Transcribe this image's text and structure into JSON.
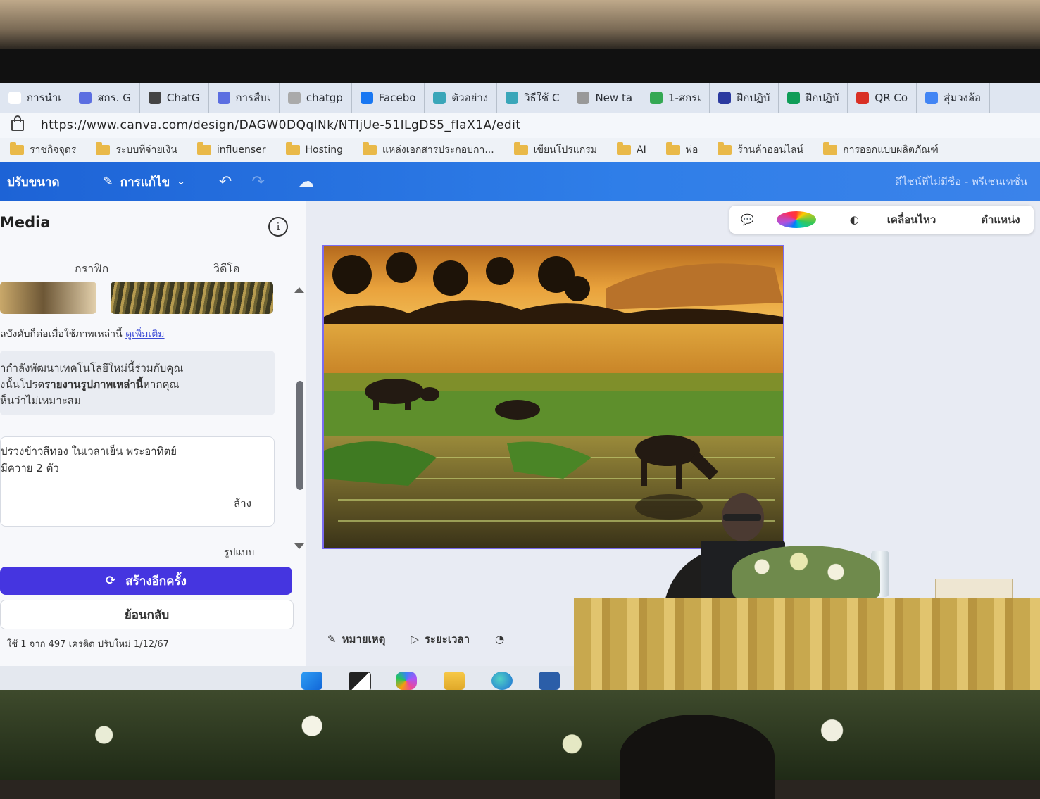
{
  "browser": {
    "tabs": [
      {
        "label": "การนำเ",
        "color": "#ffffff"
      },
      {
        "label": "สกร. G",
        "color": "#5b6ee1"
      },
      {
        "label": "ChatG",
        "color": "#444444"
      },
      {
        "label": "การสืบเ",
        "color": "#5b6ee1"
      },
      {
        "label": "chatgp",
        "color": "#aaaaaa"
      },
      {
        "label": "Facebo",
        "color": "#1877f2"
      },
      {
        "label": "ตัวอย่าง",
        "color": "#3aa6b9"
      },
      {
        "label": "วิธีใช้ C",
        "color": "#3aa6b9"
      },
      {
        "label": "New ta",
        "color": "#999999"
      },
      {
        "label": "1-สกรเ",
        "color": "#34a853"
      },
      {
        "label": "ฝึกปฏิบั",
        "color": "#2b3aa0"
      },
      {
        "label": "ฝึกปฏิบั",
        "color": "#0f9d58"
      },
      {
        "label": "QR Co",
        "color": "#d93025"
      },
      {
        "label": "สุ่มวงล้อ",
        "color": "#4285f4"
      }
    ],
    "url": "https://www.canva.com/design/DAGW0DQqlNk/NTIjUe-51lLgDS5_flaX1A/edit",
    "bookmarks": [
      "ราชกิจจุดร",
      "ระบบที่จ่ายเงิน",
      "influenser",
      "Hosting",
      "แหล่งเอกสารประกอบกา...",
      "เขียนโปรแกรม",
      "AI",
      "พ่อ",
      "ร้านค้าออนไลน์",
      "การออกแบบผลิตภัณฑ์"
    ]
  },
  "canva": {
    "topbar": {
      "resize_label": "ปรับขนาด",
      "edit_label": "การแก้ไข",
      "design_title": "ดีไซน์ที่ไม่มีชื่อ - พรีเซนเทชั่น"
    },
    "panel": {
      "title": "Media",
      "tab_graphics": "กราฟิก",
      "tab_video": "วิดีโอ",
      "notice": "ลบังคับก็ต่อเมื่อใช้ภาพเหล่านี้",
      "notice_link": "ดูเพิ่มเติม",
      "warning_line1": "ากำลังพัฒนาเทคโนโลยีใหม่นี้ร่วมกับคุณ",
      "warning_line2_prefix": "งนั้นโปรด",
      "warning_line2_link": "รายงานรูปภาพเหล่านี้",
      "warning_line2_suffix": "หากคุณ",
      "warning_line3": "ห็นว่าไม่เหมาะสม",
      "prompt_line1": "ปรวงข้าวสีทอง ในเวลาเย็น พระอาทิตย์",
      "prompt_line2": " มีควาย 2 ตัว",
      "clear_label": "ล้าง",
      "cut_label": "รูปแบบ",
      "regenerate_label": "สร้างอีกครั้ง",
      "back_label": "ย้อนกลับ",
      "credits": "ใช้ 1 จาก 497 เครดิต ปรับใหม่ 1/12/67"
    },
    "context_toolbar": {
      "animate_label": "เคลื่อนไหว",
      "position_label": "ตำแหน่ง"
    },
    "bottom": {
      "notes_label": "หมายเหตุ",
      "duration_label": "ระยะเวลา"
    }
  },
  "colors": {
    "canva_blue": "#2f7ee8",
    "regen_purple": "#4535e0",
    "selection_outline": "#7b6cf0"
  }
}
